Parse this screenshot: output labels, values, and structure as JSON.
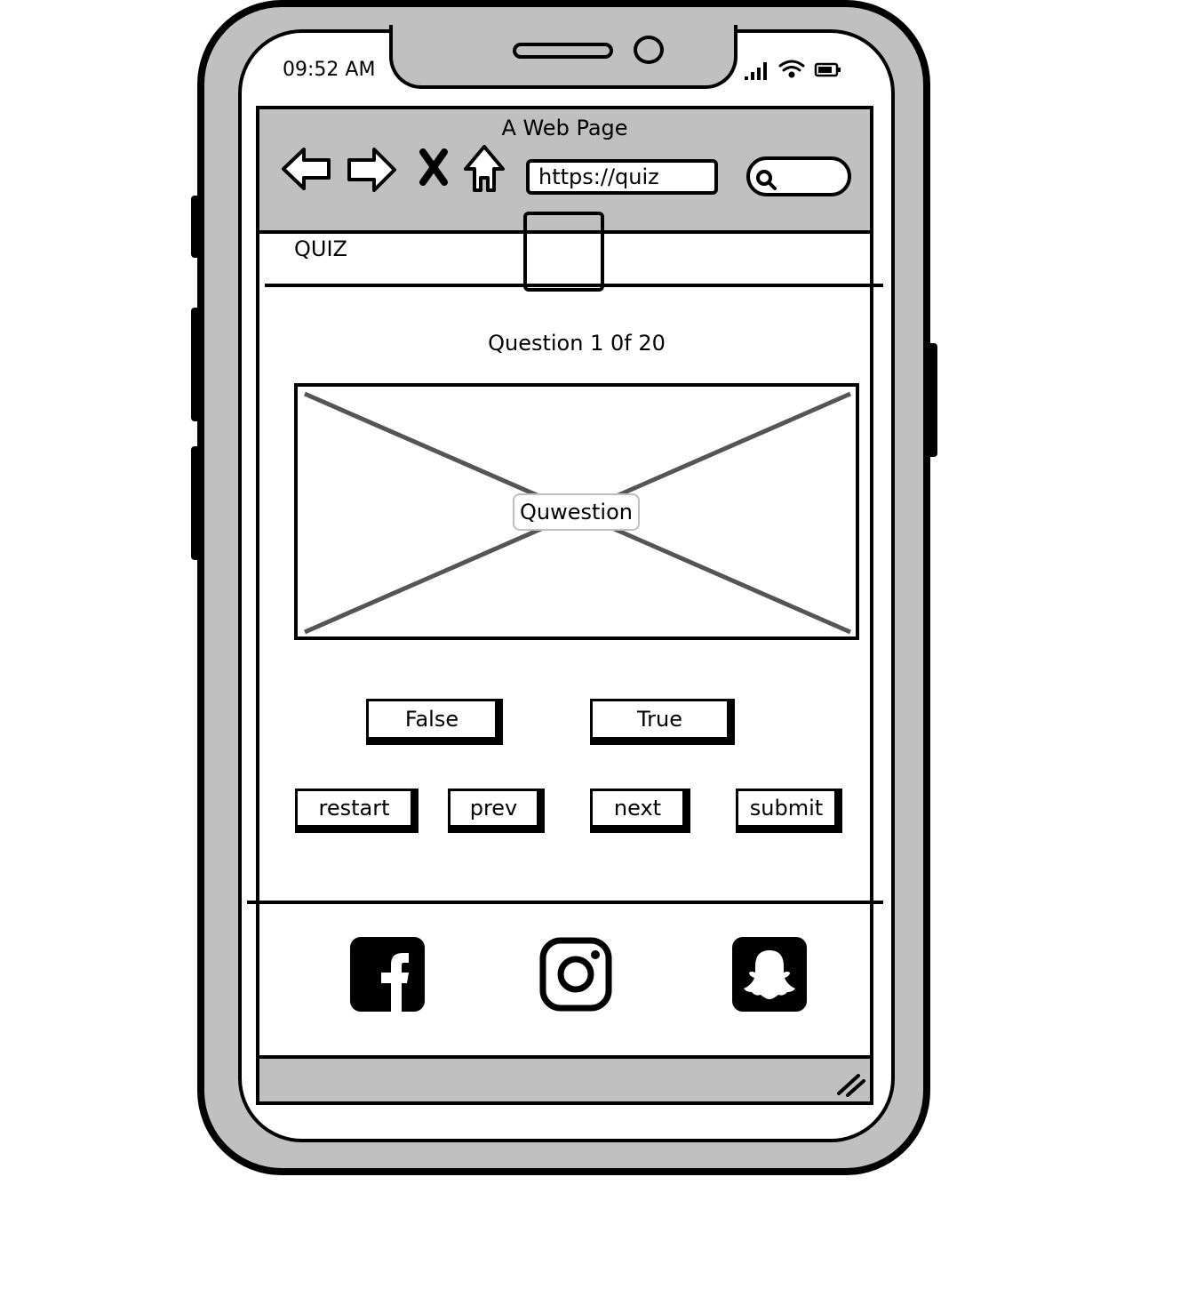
{
  "status_bar": {
    "time": "09:52 AM"
  },
  "browser": {
    "title": "A Web Page",
    "url": "https://quiz"
  },
  "app": {
    "brand": "QUIZ",
    "question_counter": "Question 1 0f 20",
    "question_placeholder": "Quwestion",
    "answers": {
      "false_label": "False",
      "true_label": "True"
    },
    "controls": {
      "restart_label": "restart",
      "prev_label": "prev",
      "next_label": "next",
      "submit_label": "submit"
    }
  },
  "footer": {
    "social": [
      "facebook-icon",
      "instagram-icon",
      "snapchat-icon"
    ]
  },
  "colors": {
    "frame_gray": "#c0c0c0",
    "ink": "#000000",
    "placeholder_x": "#555555"
  }
}
